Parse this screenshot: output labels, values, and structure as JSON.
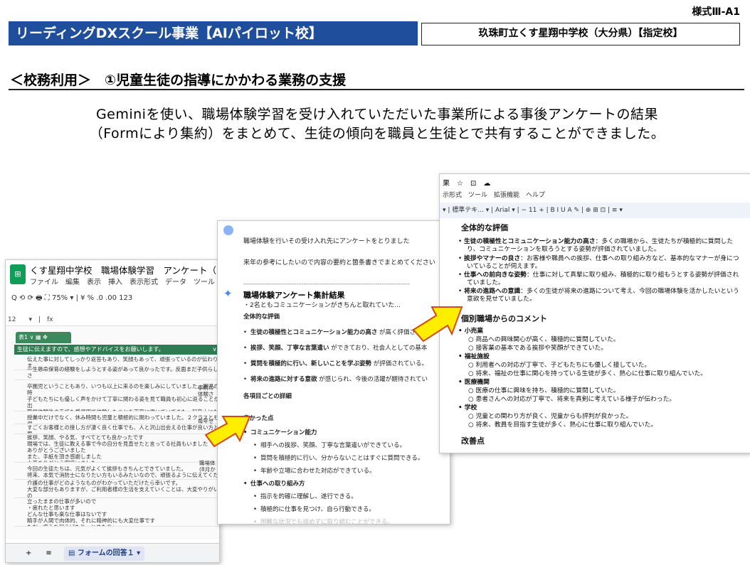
{
  "header": {
    "form_code": "様式Ⅲ-A1",
    "title": "リーディングDXスクール事業【AIパイロット校】",
    "school": "玖珠町立くす星翔中学校（大分県）【指定校】"
  },
  "section": {
    "heading": "＜校務利用＞　①児童生徒の指導にかかわる業務の支援"
  },
  "description": {
    "line1": "Geminiを使い、職場体験学習を受け入れていただいた事業所による事後アンケートの結果",
    "line2": "（Formにより集約）をまとめて、生徒の傾向を職員と生徒とで共有することができました。"
  },
  "sheet": {
    "title": "くす星翔中学校　職場体験学習　アンケート（回",
    "menu": "ファイル　編集　表示　挿入　表示形式　データ　ツール",
    "toolbar": "Q  ⟲  ⟳  🖶  ⛶   75%  ▾  |  ¥   %   .0   .00   123",
    "cell_ref": "12　　▾　|　fx",
    "table_name": "表1 ∨  ▦  ✥",
    "column_header": "生徒に伝えますので、感想やアドバイスをお願いします。　　　　　　　　　∨ その他",
    "rows": [
      {
        "n": "2",
        "text": "伝えた事に対してしっかり返答もあり、笑顔もあって、頑張っているのが伝わりま\n子どもたちの要望に答えて、沢山絵本を読んでくれたり、遊んでくれてありがとう"
      },
      {
        "n": "3",
        "text": "一生懸命保育の経験をしようとする姿があって良かったです。反面まだ子供らしさ"
      },
      {
        "n": "4",
        "text": "卒園児ということもあり、いつも以上に来るのを楽しみにしていました。園児の時\n子どもたちにも優しく声をかけて丁寧に関わる姿を見て職員も初心に返ることが出\n職場体験後の手紙も愛児園で体験したことを丁寧に書いていてまた、保育士になる\n2日間の職場体験大変お疲れ様でした。"
      },
      {
        "n": "5",
        "text": "授業中だけでなく、休み時間も児童と積極的に関わっていました。２クラスとも児"
      },
      {
        "n": "6",
        "text": "すごくお客様との接し方が凄く良く仕事でも、人と沢山出会える仕事が良い方と思"
      },
      {
        "n": "7",
        "text": "挨拶、笑顔、やる気、すべてとても良かったです\n現場では、生徒に教える事で今の自分を見直せたと言ってる社員もいました\nありがとうございました\nまた、手紙を頂き感謝しました\n大変ありがとう御座いました"
      },
      {
        "n": "8",
        "text": "今回の生徒たちは、元気がよくて挨拶もきちんとできていました。\n将来、本気で消防士になりたい方もいるみたいなので、頑張るように伝えてくださ"
      },
      {
        "n": "9",
        "text": "介護の仕事がどのようなものがわかっていただけたら幸いです。\n大変な部分もありますが、ご利用者様の生活を支えていくことは、大変やりがいの\n今後の進路の選択肢の一つに福祉の分野も考えていただけたら幸いです。"
      },
      {
        "n": "10",
        "text": "立ったままの仕事が多いので\n・疲れたと思います\nどんな仕事も楽な仕事はないです\n精手が人間で肉体的、それに精神的にも大変仕事です\nただ、痛みを和らげたり、とめたり"
      }
    ],
    "side_notes": [
      "事前の\n体験さ",
      "毎年ぜ",
      "職場体\n(8月か"
    ],
    "sheet_tab": "▤ フォームの回答１ ▾",
    "bottom_icons": "+　　≡"
  },
  "gemini": {
    "prompt_line1": "職場体験を行いその受け入れ先にアンケートをとりました",
    "prompt_line2": "来年の参考にしたいので内容の要約と箇条書きでまとめてください",
    "prompt_rule": "------------------------------------------------------------------------",
    "prompt_line3": "・2名ともコミュニケーションがきちんと取れていた...",
    "star": "✦",
    "result_title": "職場体験アンケート集計結果",
    "overall": "全体的な評価",
    "items": [
      {
        "bold": "生徒の積極性とコミュニケーション能力の高さ",
        "rest": " が高く評価さ"
      },
      {
        "bold": "挨拶、笑顔、丁寧な言葉遣い",
        "rest": " ができており、社会人としての基本"
      },
      {
        "bold": "質問を積極的に行い、新しいことを学ぶ姿勢",
        "rest": " が評価されている。"
      },
      {
        "bold": "将来の進路に対する意欲",
        "rest": " が感じられ、今後の活躍が期待されてい"
      }
    ],
    "details": "各項目ごとの詳細",
    "good_points": "良かった点",
    "comm": "コミュニケーション能力",
    "comm_items": [
      "相手への挨拶、笑顔、丁寧な言葉遣いができている。",
      "質問を積極的に行い、分からないことはすぐに質問できる。",
      "年齢や立場に合わせた対応ができている。"
    ],
    "work": "仕事への取り組み方",
    "work_items": [
      "指示を的確に理解し、遂行できる。",
      "積極的に仕事を見つけ、自ら行動できる。",
      "困難な状況でも諦めずに取り組むことができる。"
    ]
  },
  "docs": {
    "title_row": "果　☆　⊡　☁",
    "menu": "示形式　ツール　拡張機能　ヘルプ",
    "toolbar": "▾  |  標準テキ...   ▾  |  Arial    ▾  |  −  11  +  |  B   I   U   A   ✎  |  ⊕   ⊞   ⊡  |  ≡ ▾",
    "overall": "全体的な評価",
    "eval_items": [
      {
        "bold": "生徒の積極性とコミュニケーション能力の高さ",
        "rest": "：多くの職場から、生徒たちが積極的に質問したり、コミュニケーションを取ろうとする姿勢が評価されていました。"
      },
      {
        "bold": "挨拶やマナーの良さ",
        "rest": "：お客様や職員への挨拶、仕事への取り組み方など、基本的なマナーが身についていることが伺えます。"
      },
      {
        "bold": "仕事への前向きな姿勢",
        "rest": "：仕事に対して真摯に取り組み、積極的に取り組もうとする姿勢が評価されていました。"
      },
      {
        "bold": "将来の進路への意識",
        "rest": "：多くの生徒が将来の進路について考え、今回の職場体験を活かしたいという意欲を見せていました。"
      }
    ],
    "comments_head": "個別職場からのコメント",
    "groups": [
      {
        "name": "小売業",
        "items": [
          "商品への興味関心が高く、積極的に質問していた。",
          "接客業の基本である挨拶や笑顔ができていた。"
        ]
      },
      {
        "name": "福祉施設",
        "items": [
          "利用者への対応が丁寧で、子どもたちにも優しく接していた。",
          "将来、福祉の仕事に関心を持っている生徒が多く、熱心に仕事に取り組んでいた。"
        ]
      },
      {
        "name": "医療機関",
        "items": [
          "医療の仕事に興味を持ち、積極的に質問していた。",
          "患者さんへの対応が丁寧で、将来を真剣に考えている様子が伝わった。"
        ]
      },
      {
        "name": "学校",
        "items": [
          "児童との関わり方が良く、児童からも評判が良かった。",
          "将来、教員を目指す生徒が多く、熱心に仕事に取り組んでいた。"
        ]
      }
    ],
    "improve": "改善点"
  },
  "colors": {
    "title_bg": "#1f4e9c",
    "sheets_green": "#0f9d58",
    "arrow_fill": "#ffee00",
    "arrow_stroke": "#d9480f"
  }
}
